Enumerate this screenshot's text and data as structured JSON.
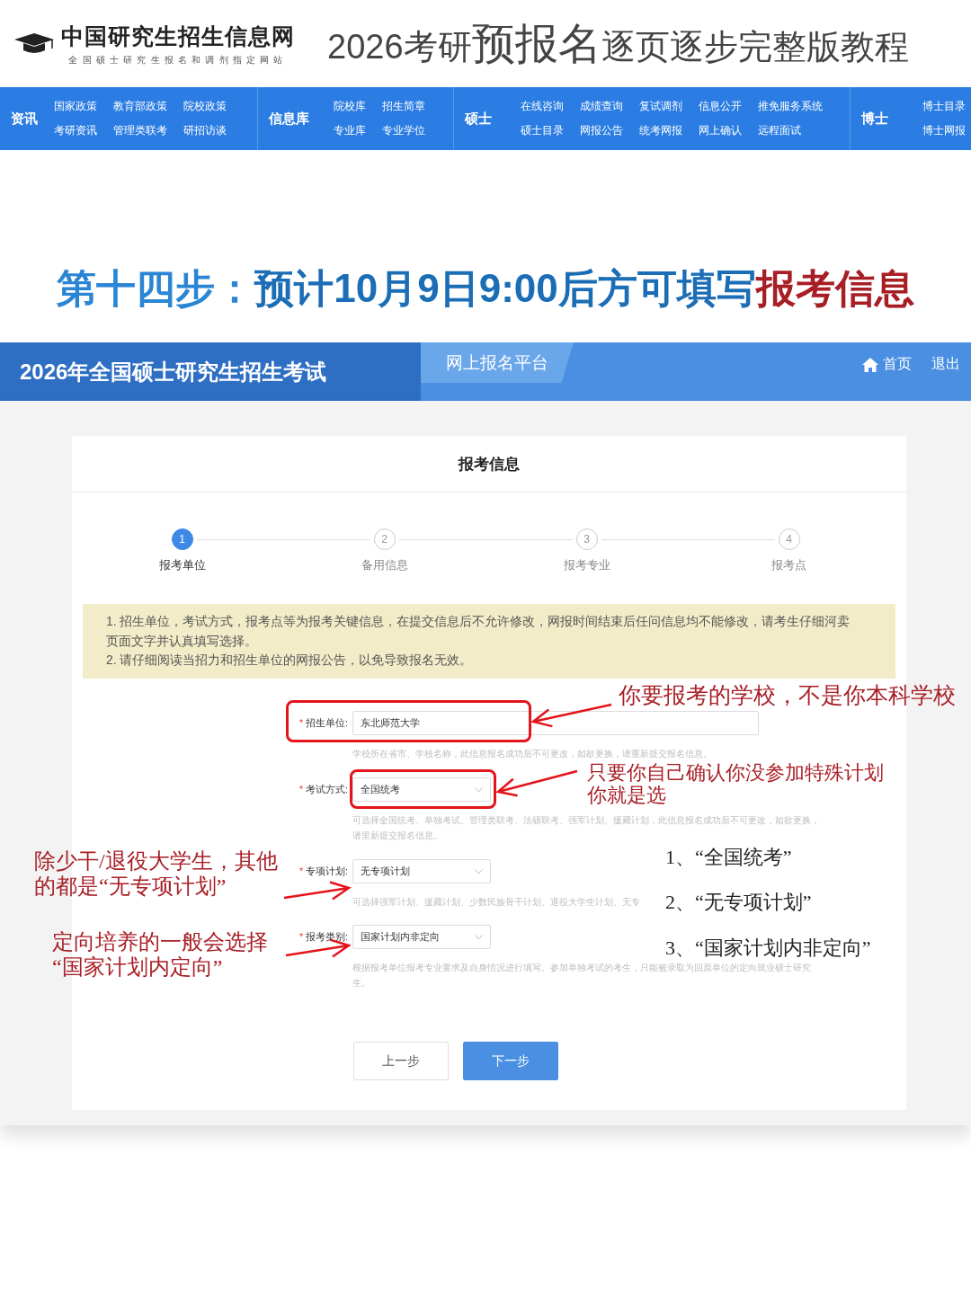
{
  "header": {
    "logo": {
      "name": "中国研究生招生信息网",
      "tagline": "全国硕士研究生报名和调剂指定网站"
    },
    "title": [
      {
        "text": "2026考研",
        "kind": "normal"
      },
      {
        "text": "预报名",
        "kind": "large"
      },
      {
        "text": "逐页逐步完整版教程",
        "kind": "normal"
      }
    ]
  },
  "nav": [
    {
      "title": "资讯",
      "items": [
        "国家政策",
        "教育部政策",
        "院校政策",
        "考研资讯",
        "管理类联考",
        "研招访谈"
      ]
    },
    {
      "title": "信息库",
      "items": [
        "院校库",
        "招生简章",
        "专业库",
        "专业学位"
      ]
    },
    {
      "title": "硕士",
      "items": [
        "在线咨询",
        "成绩查询",
        "复试调剂",
        "信息公开",
        "推免服务系统",
        "硕士目录",
        "网报公告",
        "统考网报",
        "网上确认",
        "远程面试"
      ]
    },
    {
      "title": "博士",
      "items": [
        "博士目录",
        "博士网报"
      ]
    }
  ],
  "step_heading": [
    {
      "text": "第十四步：",
      "color": "#2a86d4"
    },
    {
      "text": "预计10月9日9:00后方可填写",
      "color": "#1b6db5"
    },
    {
      "text": "报考信息",
      "color": "#a81e25"
    }
  ],
  "platform": {
    "title": "2026年全国硕士研究生招生考试",
    "tab": "网上报名平台",
    "links": [
      "首页",
      "退出"
    ]
  },
  "form": {
    "title": "报考信息",
    "steps": [
      {
        "number": "1",
        "label": "报考单位",
        "selected": true
      },
      {
        "number": "2",
        "label": "备用信息",
        "selected": false
      },
      {
        "number": "3",
        "label": "报考专业",
        "selected": false
      },
      {
        "number": "4",
        "label": "报考点",
        "selected": false
      }
    ],
    "notice": [
      "1. 招生单位，考试方式，报考点等为报考关键信息，在提交信息后不允许修改，网报时间结束后任问信息均不能修改，请考生仔细河卖页面文字并认真填写选择。",
      "2. 请仔细阅读当招力和招生单位的网报公告，以免导致报名无效。"
    ],
    "fields": [
      {
        "kind": "input",
        "required": true,
        "required_mark": "*",
        "label": "招生单位:",
        "value": "东北师范大学",
        "hint": "学校所在省市、学校名称，此信息报名成功后不可更改，如欲更换，请重新提交报名信息。"
      },
      {
        "kind": "select",
        "required": true,
        "required_mark": "*",
        "label": "考试方式:",
        "value": "全国统考",
        "hint": "可选择全国统考、单独考试、管理类联考、法硕联考、强军计划、援藏计划，此信息报名成功后不可更改，如欲更换，请里新提交报名信息。"
      },
      {
        "kind": "select",
        "required": true,
        "required_mark": "*",
        "label": "专项计划:",
        "value": "无专项计划",
        "hint": "可选择强军计划、援藏计划、少数民族骨干计划、退役大学生计划、无专"
      },
      {
        "kind": "select",
        "required": true,
        "required_mark": "*",
        "label": "报考类别:",
        "value": "国家计划内非定向",
        "hint": "根据报考单位报考专业要求及自身情况进行填写。参加单独考试的考生，只能被录取为回原单位的定向就业硕士研究生。"
      }
    ],
    "buttons": [
      {
        "label": "上一步",
        "kind": "secondary"
      },
      {
        "label": "下一步",
        "kind": "primary"
      }
    ]
  },
  "annotations": [
    {
      "kind": "note",
      "lines": [
        "你要报考的学校，不是你本科学校"
      ]
    },
    {
      "kind": "note",
      "lines": [
        "只要你自己确认你没参加特殊计划",
        "你就是选"
      ]
    },
    {
      "kind": "note",
      "lines": [
        "除少干/退役大学生，其他",
        "的都是“无专项计划”"
      ]
    },
    {
      "kind": "note",
      "lines": [
        "定向培养的一般会选择",
        "“国家计划内定向”"
      ]
    },
    {
      "kind": "list",
      "lines": [
        "1、“全国统考”",
        "2、“无专项计划”",
        "3、“国家计划内非定向”"
      ]
    }
  ]
}
